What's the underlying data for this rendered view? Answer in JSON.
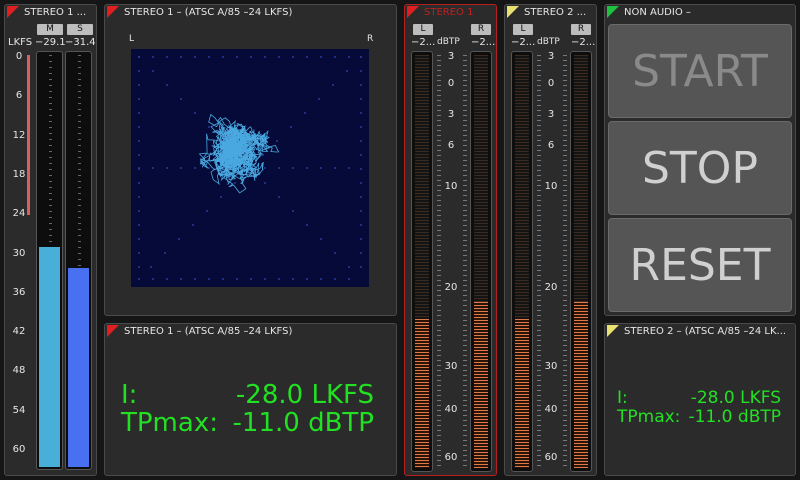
{
  "loudness_panel": {
    "title": "STEREO 1 ...",
    "unit": "LKFS",
    "btn_m": "M",
    "btn_s": "S",
    "m_value": "−29.1",
    "s_value": "−31.4",
    "scale": [
      "0",
      "6",
      "12",
      "18",
      "24",
      "30",
      "36",
      "42",
      "48",
      "54",
      "60"
    ],
    "m_level_fraction": 0.53,
    "s_level_fraction": 0.48,
    "m_color": "#48b0d8",
    "s_color": "#4870f0"
  },
  "vector_panel": {
    "title": "STEREO 1 – (ATSC A/85 –24 LKFS)",
    "label_l": "L",
    "label_r": "R"
  },
  "stereo1_readout": {
    "title": "STEREO 1 – (ATSC A/85 –24 LKFS)",
    "i_label": "I:",
    "i_value": "-28.0 LKFS",
    "tp_label": "TPmax:",
    "tp_value": "-11.0 dBTP"
  },
  "tp_meter_1": {
    "title": "STEREO 1",
    "btn_l": "L",
    "btn_r": "R",
    "l_value": "−2...",
    "unit": "dBTP",
    "r_value": "−2...",
    "l_level_fraction": 0.36,
    "r_level_fraction": 0.4
  },
  "tp_meter_2": {
    "title": "STEREO 2 ...",
    "btn_l": "L",
    "btn_r": "R",
    "l_value": "−2...",
    "unit": "dBTP",
    "r_value": "−2...",
    "l_level_fraction": 0.36,
    "r_level_fraction": 0.4
  },
  "tp_scale": [
    "3",
    "0",
    "3",
    "6",
    "10",
    "20",
    "30",
    "40",
    "60"
  ],
  "control_panel": {
    "title": "NON AUDIO –",
    "start_label": "START",
    "stop_label": "STOP",
    "reset_label": "RESET"
  },
  "stereo2_readout": {
    "title": "STEREO 2 – (ATSC A/85 –24 LK...",
    "i_label": "I:",
    "i_value": "-28.0 LKFS",
    "tp_label": "TPmax:",
    "tp_value": "-11.0 dBTP"
  },
  "colors": {
    "readout_green": "#22e022",
    "vector_trace": "#4aa8e0",
    "vector_bg": "#050a38",
    "alarm_red": "#e02020"
  }
}
